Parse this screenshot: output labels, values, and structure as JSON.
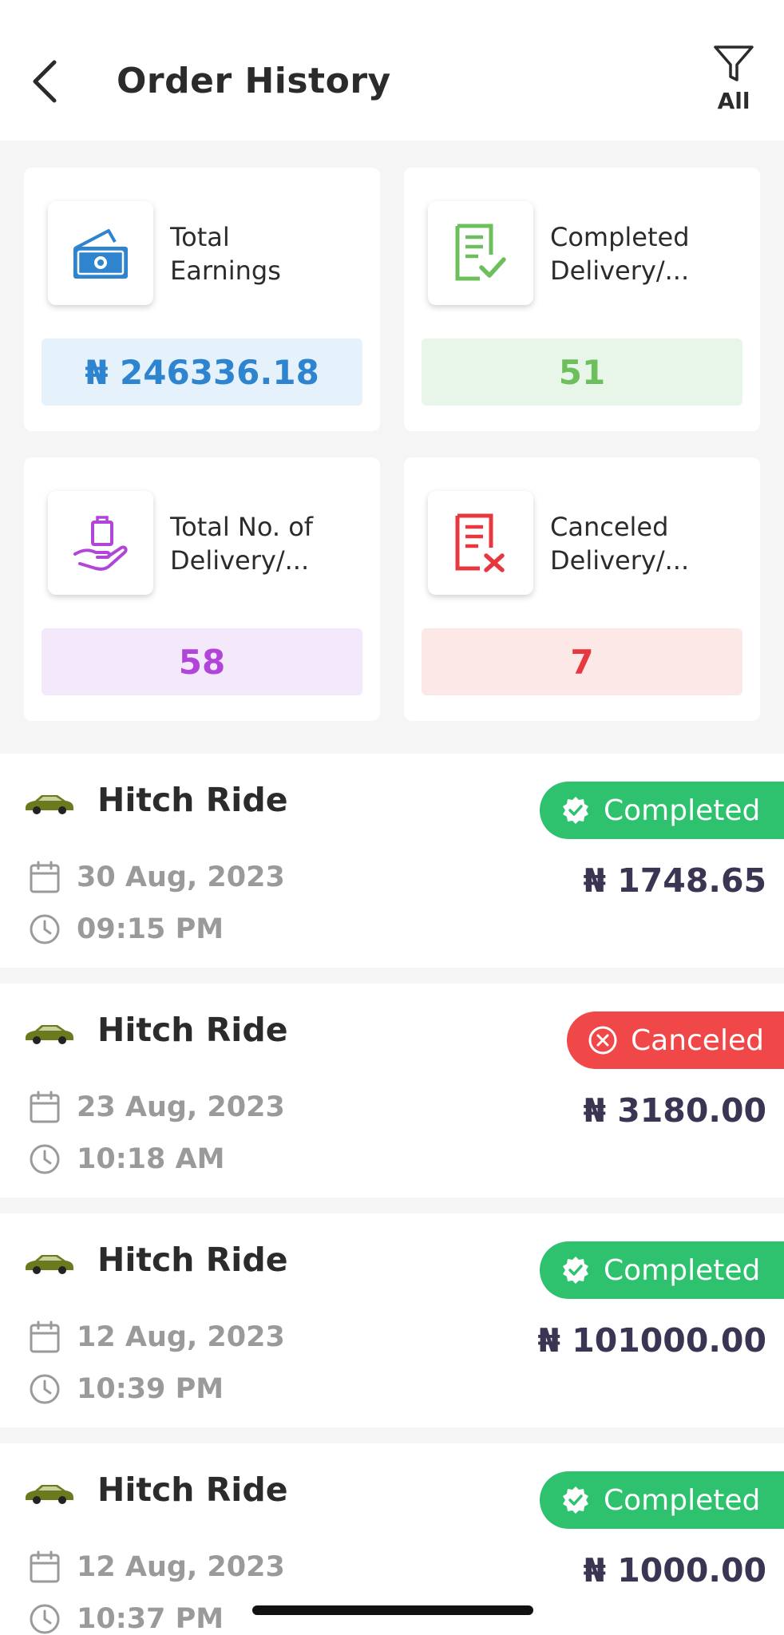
{
  "header": {
    "title": "Order History",
    "back_icon": "chevron-left-icon",
    "filter_icon": "filter-funnel-icon",
    "filter_label": "All"
  },
  "stats": [
    {
      "id": "total-earnings",
      "label_line1": "Total",
      "label_line2": "Earnings",
      "value": "₦ 246336.18",
      "icon": "money-stack-icon",
      "accent": "#2f84cf",
      "value_bg": "#e5f1fb"
    },
    {
      "id": "completed-delivery",
      "label_line1": "Completed",
      "label_line2": "Delivery/...",
      "value": "51",
      "icon": "document-check-icon",
      "accent": "#6cbf5c",
      "value_bg": "#e8f6ea"
    },
    {
      "id": "total-deliveries",
      "label_line1": "Total No. of",
      "label_line2": "Delivery/...",
      "value": "58",
      "icon": "hand-shopping-bag-icon",
      "accent": "#b144d9",
      "value_bg": "#f4e8fb"
    },
    {
      "id": "canceled-delivery",
      "label_line1": "Canceled",
      "label_line2": "Delivery/...",
      "value": "7",
      "icon": "document-x-icon",
      "accent": "#e8383f",
      "value_bg": "#fde8e8"
    }
  ],
  "orders": [
    {
      "title": "Hitch Ride",
      "status": "Completed",
      "date": "30 Aug, 2023",
      "time": "09:15 PM",
      "amount": "₦ 1748.65"
    },
    {
      "title": "Hitch Ride",
      "status": "Canceled",
      "date": "23 Aug, 2023",
      "time": "10:18 AM",
      "amount": "₦ 3180.00"
    },
    {
      "title": "Hitch Ride",
      "status": "Completed",
      "date": "12 Aug, 2023",
      "time": "10:39 PM",
      "amount": "₦ 101000.00"
    },
    {
      "title": "Hitch Ride",
      "status": "Completed",
      "date": "12 Aug, 2023",
      "time": "10:37 PM",
      "amount": "₦ 1000.00"
    }
  ],
  "colors": {
    "completed": "#2ec26e",
    "canceled": "#f04848",
    "amount": "#3b3452",
    "muted": "#9a9a9a",
    "car": "#6b7a1f"
  }
}
